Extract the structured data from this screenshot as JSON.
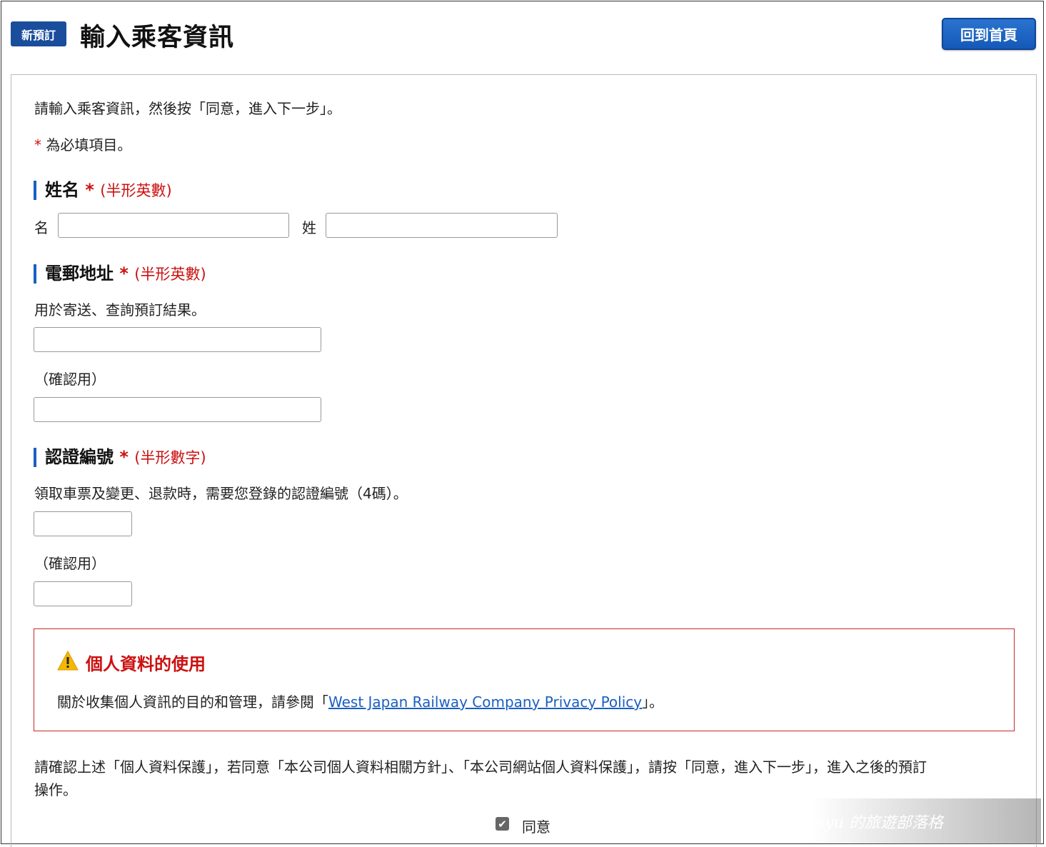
{
  "header": {
    "badge": "新預訂",
    "title": "輸入乘客資訊",
    "home_button": "回到首頁"
  },
  "intro": {
    "instruction": "請輸入乘客資訊，然後按「同意，進入下一步」。",
    "required_mark": "*",
    "required_note": "為必填項目。"
  },
  "name_section": {
    "title": "姓名",
    "required_mark": "*",
    "note": "(半形英數)",
    "first_label": "名",
    "last_label": "姓",
    "first_value": "",
    "last_value": ""
  },
  "email_section": {
    "title": "電郵地址",
    "required_mark": "*",
    "note": "(半形英數)",
    "description": "用於寄送、查詢預訂結果。",
    "confirm_label": "（確認用）",
    "email_value": "",
    "email_confirm_value": ""
  },
  "pin_section": {
    "title": "認證編號",
    "required_mark": "*",
    "note": "(半形數字)",
    "description": "領取車票及變更、退款時，需要您登錄的認證編號（4碼）。",
    "confirm_label": "（確認用）",
    "pin_value": "",
    "pin_confirm_value": ""
  },
  "privacy": {
    "title": "個人資料的使用",
    "text_before": "關於收集個人資訊的目的和管理，請參閱「",
    "link_text": "West Japan Railway Company Privacy Policy",
    "text_after": "」。"
  },
  "consent": {
    "text": "請確認上述「個人資料保護」，若同意「本公司個人資料相關方針」、「本公司網站個人資料保護」，請按「同意，進入下一步」，進入之後的預訂",
    "text_line2": "操作。",
    "agree_label": "同意",
    "agree_checked": true
  },
  "watermark": "syu 的旅遊部落格"
}
